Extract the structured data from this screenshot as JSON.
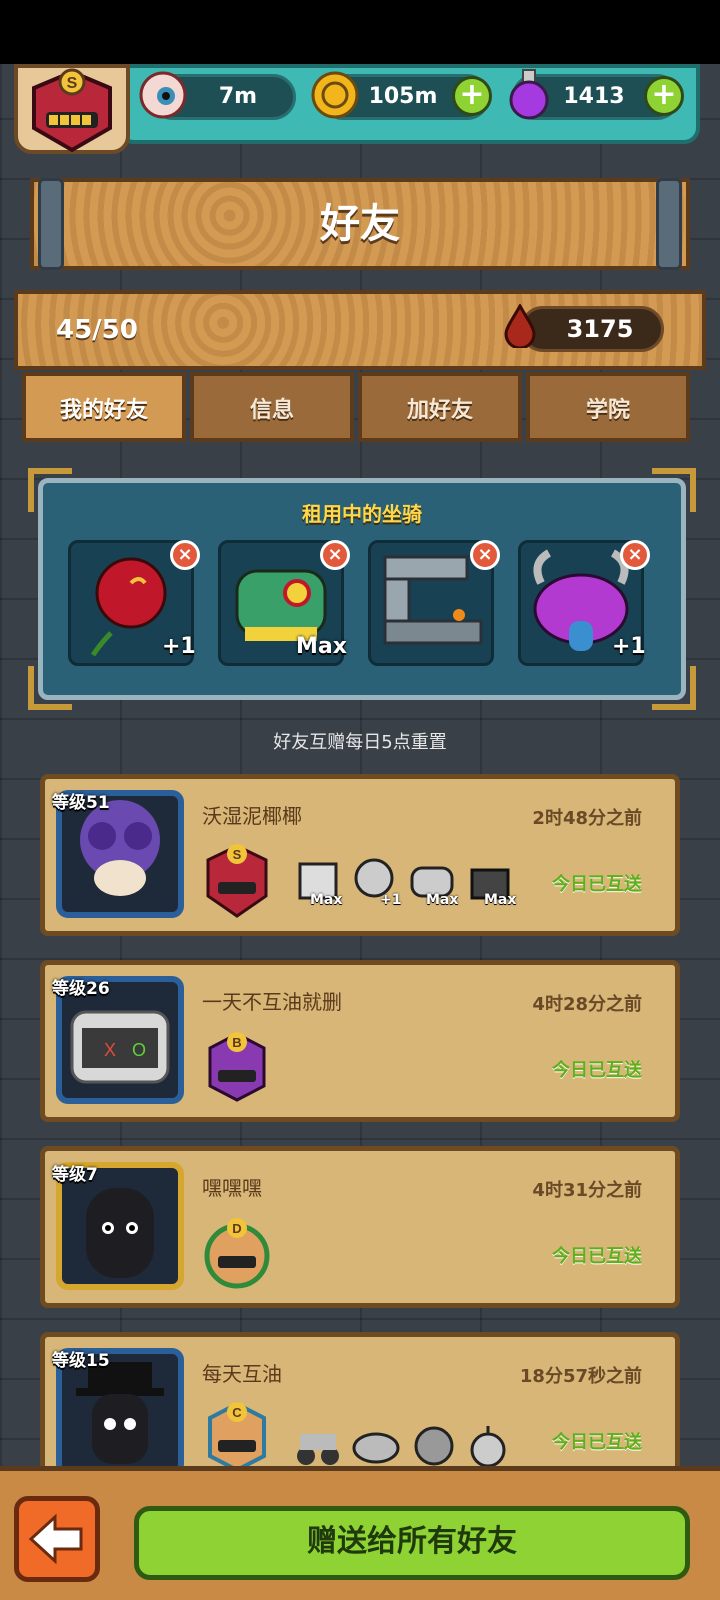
{
  "resources": {
    "eye": {
      "icon": "eye-icon",
      "value": "7m"
    },
    "coin": {
      "icon": "coin-icon",
      "value": "105m"
    },
    "potion": {
      "icon": "potion-icon",
      "value": "1413"
    }
  },
  "player_rank": "S",
  "page_title": "好友",
  "friend_count": "45/50",
  "oil_total": "3175",
  "tabs": [
    {
      "label": "我的好友",
      "active": true
    },
    {
      "label": "信息",
      "active": false
    },
    {
      "label": "加好友",
      "active": false
    },
    {
      "label": "学院",
      "active": false
    }
  ],
  "rented_mounts": {
    "title": "租用中的坐骑",
    "slots": [
      {
        "icon": "rose-mount-icon",
        "badge": "+1"
      },
      {
        "icon": "lion-dance-mount-icon",
        "badge": "Max"
      },
      {
        "icon": "machine-mount-icon",
        "badge": ""
      },
      {
        "icon": "purple-monster-mount-icon",
        "badge": "+1"
      }
    ]
  },
  "reset_note": "好友互赠每日5点重置",
  "friends": [
    {
      "level": "等级51",
      "name": "沃湿泥椰椰",
      "time": "2时48分之前",
      "status": "今日已互送",
      "rank": "S",
      "mounts": [
        {
          "badge": "Max"
        },
        {
          "badge": "+1"
        },
        {
          "badge": "Max"
        },
        {
          "badge": "Max"
        }
      ]
    },
    {
      "level": "等级26",
      "name": "一天不互油就删",
      "time": "4时28分之前",
      "status": "今日已互送",
      "rank": "B",
      "mounts": []
    },
    {
      "level": "等级7",
      "name": "嘿嘿嘿",
      "time": "4时31分之前",
      "status": "今日已互送",
      "rank": "D",
      "mounts": []
    },
    {
      "level": "等级15",
      "name": "每天互油",
      "time": "18分57秒之前",
      "status": "今日已互送",
      "rank": "C",
      "mounts": [
        {
          "badge": ""
        },
        {
          "badge": ""
        },
        {
          "badge": ""
        },
        {
          "badge": ""
        }
      ]
    }
  ],
  "send_all_label": "赠送给所有好友",
  "colors": {
    "teal": "#3fb9b4",
    "wood": "#d39a54",
    "green": "#8fd234",
    "panel": "#2a6176"
  }
}
